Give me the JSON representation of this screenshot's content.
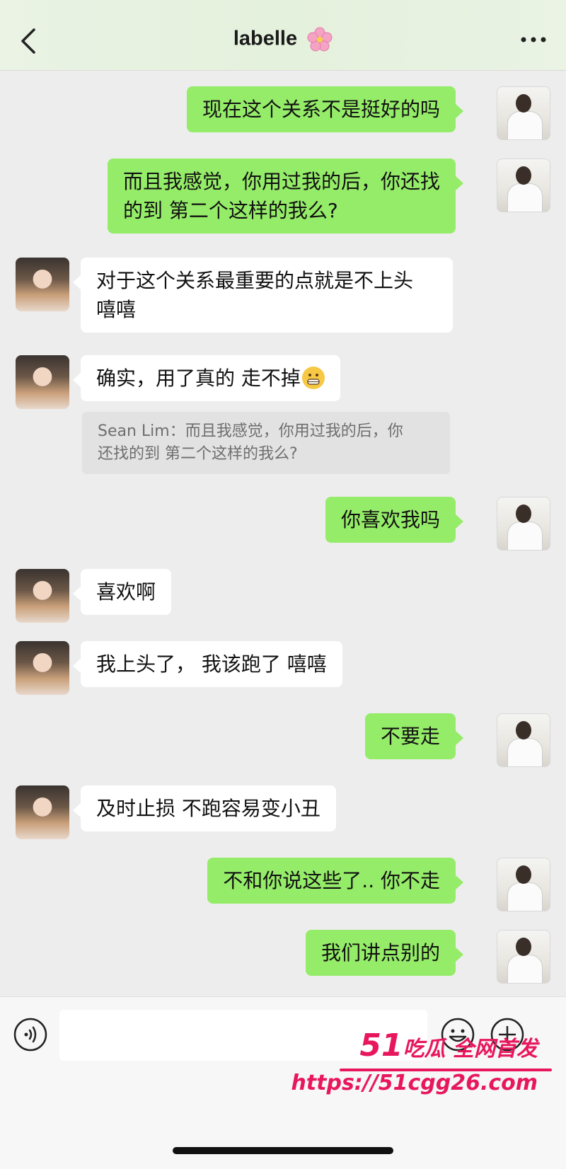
{
  "header": {
    "title": "labelle",
    "title_emoji": "🌸"
  },
  "messages": [
    {
      "side": "right",
      "text": "现在这个关系不是挺好的吗"
    },
    {
      "side": "right",
      "line1": "而且我感觉，你用过我的后，你还找",
      "line2": "的到 第二个这样的我么?"
    },
    {
      "side": "left",
      "line1": "对于这个关系最重要的点就是不上头",
      "line2": "嘻嘻"
    },
    {
      "side": "left",
      "text": "确实，用了真的 走不掉",
      "emoji": "😬"
    },
    {
      "side": "quote",
      "line1": "Sean Lim：而且我感觉，你用过我的后，你",
      "line2": "还找的到 第二个这样的我么?"
    },
    {
      "side": "right",
      "text": "你喜欢我吗"
    },
    {
      "side": "left",
      "text": "喜欢啊"
    },
    {
      "side": "left",
      "text": "我上头了， 我该跑了 嘻嘻"
    },
    {
      "side": "right",
      "text": "不要走"
    },
    {
      "side": "left",
      "text": "及时止损 不跑容易变小丑"
    },
    {
      "side": "right",
      "text": "不和你说这些了.. 你不走"
    },
    {
      "side": "right",
      "text": "我们讲点别的"
    }
  ],
  "input": {
    "placeholder": ""
  },
  "watermark": {
    "line1_num": "51",
    "line1_text": "吃瓜 全网首发",
    "line2": "https://51cgg26.com"
  },
  "colors": {
    "green_bubble": "#95ec69",
    "white_bubble": "#ffffff",
    "background": "#ededed",
    "watermark": "#e8175d"
  }
}
